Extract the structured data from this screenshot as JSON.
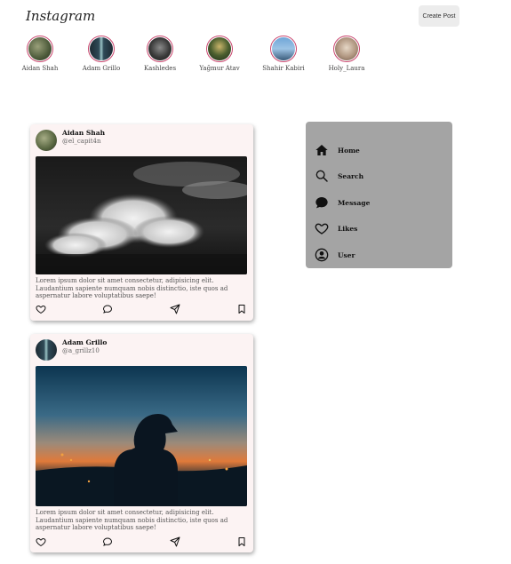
{
  "header": {
    "logo": "Instagram",
    "create_post": "Create Post"
  },
  "stories": [
    {
      "name": "Aidan Shah"
    },
    {
      "name": "Adam Grillo"
    },
    {
      "name": "Kashledes"
    },
    {
      "name": "Yağmur Atav"
    },
    {
      "name": "Shahir Kabiri"
    },
    {
      "name": "Holy_Laura"
    }
  ],
  "posts": [
    {
      "name": "Aidan Shah",
      "handle": "@el_capit4n",
      "caption": "Lorem ipsum dolor sit amet consectetur, adipisicing elit. Laudantium sapiente numquam nobis distinctio, iste quos ad aspernatur labore voluptatibus saepe!"
    },
    {
      "name": "Adam Grillo",
      "handle": "@a_grillz10",
      "caption": "Lorem ipsum dolor sit amet consectetur, adipisicing elit. Laudantium sapiente numquam nobis distinctio, iste quos ad aspernatur labore voluptatibus saepe!"
    }
  ],
  "menu": [
    {
      "label": "Home",
      "icon": "home-icon"
    },
    {
      "label": "Search",
      "icon": "search-icon"
    },
    {
      "label": "Message",
      "icon": "message-icon"
    },
    {
      "label": "Likes",
      "icon": "heart-icon"
    },
    {
      "label": "User",
      "icon": "user-icon"
    }
  ],
  "colors": {
    "story_ring": "#c9466e",
    "menu_bg": "#a4a4a4",
    "post_bg": "#fcf3f3"
  }
}
